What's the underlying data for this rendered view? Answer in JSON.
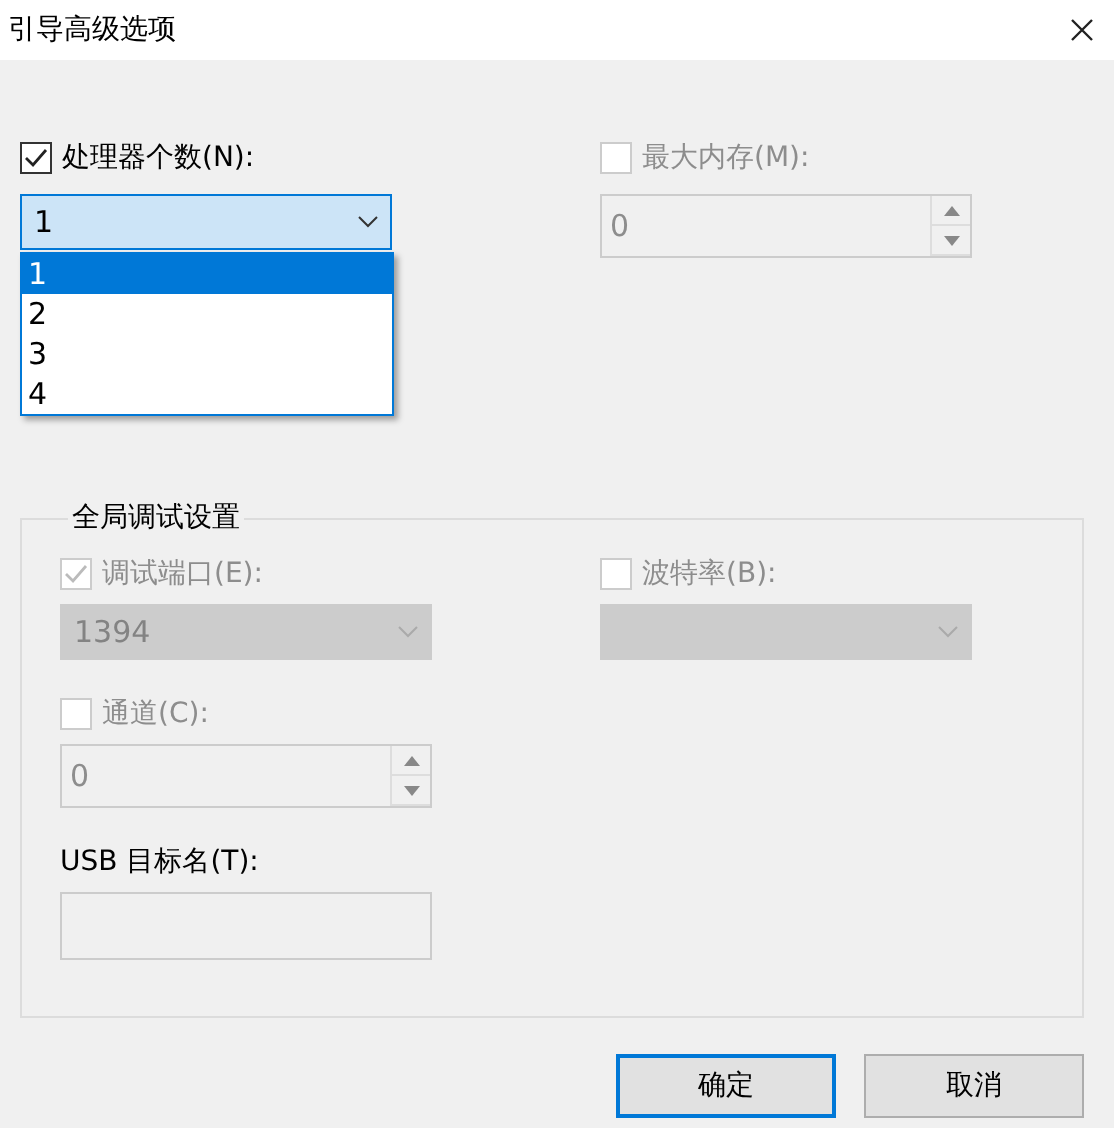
{
  "window": {
    "title": "引导高级选项"
  },
  "processor": {
    "label": "处理器个数(N):",
    "checked": true,
    "value": "1",
    "expanded": true,
    "options": [
      {
        "label": "1",
        "selected": true
      },
      {
        "label": "2",
        "selected": false
      },
      {
        "label": "3",
        "selected": false
      },
      {
        "label": "4",
        "selected": false
      }
    ]
  },
  "max_memory": {
    "label": "最大内存(M):",
    "checked": false,
    "disabled": true,
    "value": "0"
  },
  "debug_settings": {
    "title": "全局调试设置",
    "debug_port": {
      "label": "调试端口(E):",
      "checked": true,
      "disabled": true,
      "value": "1394"
    },
    "baud_rate": {
      "label": "波特率(B):",
      "checked": false,
      "disabled": true
    },
    "channel": {
      "label": "通道(C):",
      "checked": false,
      "disabled": true,
      "value": "0"
    },
    "usb_target": {
      "label": "USB 目标名(T):",
      "disabled": true
    }
  },
  "buttons": [
    {
      "label": "确定",
      "default": true
    },
    {
      "label": "取消",
      "default": false
    }
  ]
}
